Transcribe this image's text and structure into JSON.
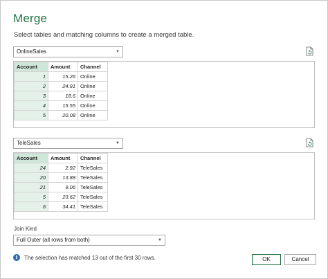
{
  "dialog": {
    "title": "Merge",
    "subtitle": "Select tables and matching columns to create a merged table."
  },
  "table1": {
    "selected": "OnlineSales",
    "headers": [
      "Account",
      "Amount",
      "Channel"
    ],
    "rows": [
      [
        "1",
        "15.26",
        "Online"
      ],
      [
        "2",
        "24.91",
        "Online"
      ],
      [
        "3",
        "18.6",
        "Online"
      ],
      [
        "4",
        "15.55",
        "Online"
      ],
      [
        "5",
        "20.08",
        "Online"
      ]
    ]
  },
  "table2": {
    "selected": "TeleSales",
    "headers": [
      "Account",
      "Amount",
      "Channel"
    ],
    "rows": [
      [
        "24",
        "2.92",
        "TeleSales"
      ],
      [
        "20",
        "13.88",
        "TeleSales"
      ],
      [
        "21",
        "9.06",
        "TeleSales"
      ],
      [
        "5",
        "23.62",
        "TeleSales"
      ],
      [
        "6",
        "34.41",
        "TeleSales"
      ]
    ]
  },
  "join": {
    "label": "Join Kind",
    "selected": "Full Outer (all rows from both)"
  },
  "status": {
    "message": "The selection has matched 13 out of the first 30 rows."
  },
  "buttons": {
    "ok": "OK",
    "cancel": "Cancel"
  },
  "colors": {
    "accent": "#217346",
    "selected_header": "#cfe7d9",
    "selected_cell": "#e4f1e9",
    "info": "#2b6cb0"
  },
  "icons": {
    "combo_caret": "chevron-down-icon",
    "refresh": "refresh-preview-icon",
    "info": "info-icon"
  }
}
